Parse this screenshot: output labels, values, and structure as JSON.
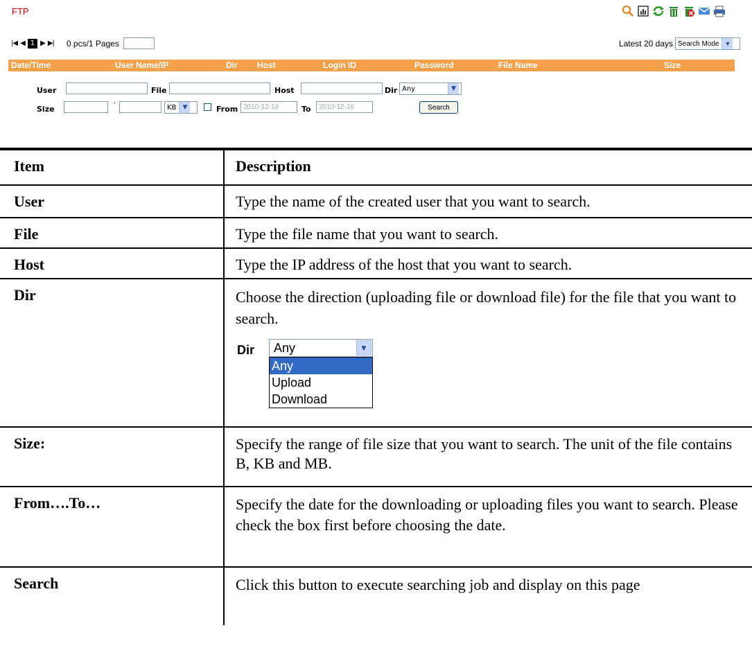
{
  "header": {
    "title": "FTP"
  },
  "toolbar": {
    "icons": [
      "search-icon",
      "export-icon",
      "refresh-icon",
      "delete-icon",
      "clear-icon",
      "mail-icon",
      "print-icon"
    ]
  },
  "pager": {
    "first": "|◀",
    "prev": "◀",
    "current": "1",
    "next": "▶",
    "last": "▶|",
    "info": "0 pcs/1 Pages",
    "page_input": ""
  },
  "latest": {
    "label": "Latest 20 days",
    "mode": "Search Mode"
  },
  "columns": [
    "Date/Time",
    "User Name/IP",
    "Dir",
    "Host",
    "Login ID",
    "Password",
    "File Name",
    "Size"
  ],
  "search_form": {
    "user_label": "User",
    "file_label": "File",
    "host_label": "Host",
    "dir_label": "Dir",
    "dir_value": "Any",
    "size_label": "Size",
    "size_sep": "`",
    "unit_value": "KB",
    "from_label": "From",
    "from_value": "2010-12-16",
    "to_label": "To",
    "to_value": "2010-12-16",
    "search_button": "Search"
  },
  "desc_table": {
    "header": [
      "Item",
      "Description"
    ],
    "rows": [
      {
        "item": "User",
        "desc": "Type the name of the created user that you want to search."
      },
      {
        "item": "File",
        "desc": "Type the file name that you want to search."
      },
      {
        "item": "Host",
        "desc": "Type the IP address of the host that you want to search."
      },
      {
        "item": "Dir",
        "desc": "Choose the direction (uploading file or download file) for the file that you want to search."
      },
      {
        "item": "Size:",
        "desc": "Specify the range of file size that you want to search. The unit of the file contains B, KB and MB."
      },
      {
        "item": "From….To…",
        "desc": "Specify the date for the downloading or uploading files you want to search. Please check the box first before choosing the date."
      },
      {
        "item": "Search",
        "desc": "Click this button to execute searching job and display on this page"
      }
    ],
    "dir_demo": {
      "label": "Dir",
      "value": "Any",
      "options": [
        "Any",
        "Upload",
        "Download"
      ]
    }
  },
  "colors": {
    "accent_bar": "#f5a04a",
    "title_red": "#cc0000"
  }
}
